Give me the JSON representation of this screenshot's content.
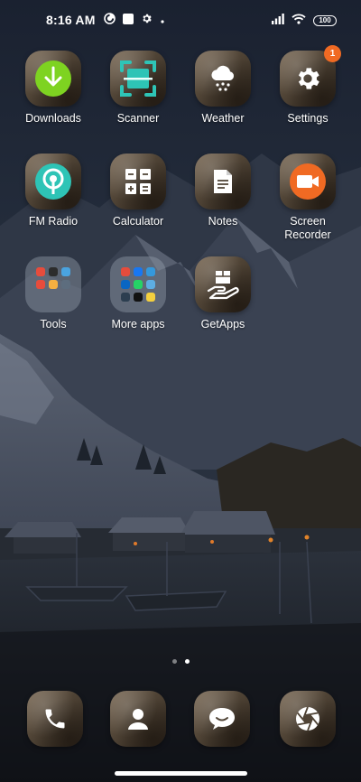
{
  "status_bar": {
    "time": "8:16 AM",
    "battery_level": "100",
    "left_icons": [
      "data-saver-icon",
      "square-notification-icon",
      "gear-icon",
      "dot-icon"
    ],
    "right_icons": [
      "signal-icon",
      "wifi-icon",
      "battery-icon"
    ]
  },
  "apps": [
    {
      "label": "Downloads",
      "icon": "download-icon",
      "accent": "#7ed321"
    },
    {
      "label": "Scanner",
      "icon": "scanner-icon",
      "accent": "#2ec4b6"
    },
    {
      "label": "Weather",
      "icon": "cloud-snow-icon",
      "accent": "#ffffff"
    },
    {
      "label": "Settings",
      "icon": "gear-icon",
      "accent": "#ffffff",
      "badge": "1"
    },
    {
      "label": "FM Radio",
      "icon": "radio-icon",
      "accent": "#2ec4b6"
    },
    {
      "label": "Calculator",
      "icon": "calculator-icon",
      "accent": "#ffffff"
    },
    {
      "label": "Notes",
      "icon": "note-icon",
      "accent": "#ffffff"
    },
    {
      "label": "Screen\nRecorder",
      "icon": "video-camera-icon",
      "accent": "#f06a23"
    },
    {
      "label": "Tools",
      "icon": "folder-icon"
    },
    {
      "label": "More apps",
      "icon": "folder-icon"
    },
    {
      "label": "GetApps",
      "icon": "box-hand-icon",
      "accent": "#ffffff"
    }
  ],
  "dock": [
    {
      "icon": "phone-icon"
    },
    {
      "icon": "contacts-icon"
    },
    {
      "icon": "chat-bubble-icon"
    },
    {
      "icon": "camera-aperture-icon"
    }
  ],
  "page_indicator": {
    "pages": 2,
    "current": 2
  },
  "colors": {
    "badge": "#f06a23",
    "icon_frame": "#5a4b3c",
    "wallpaper_sky": "#1e2633"
  }
}
